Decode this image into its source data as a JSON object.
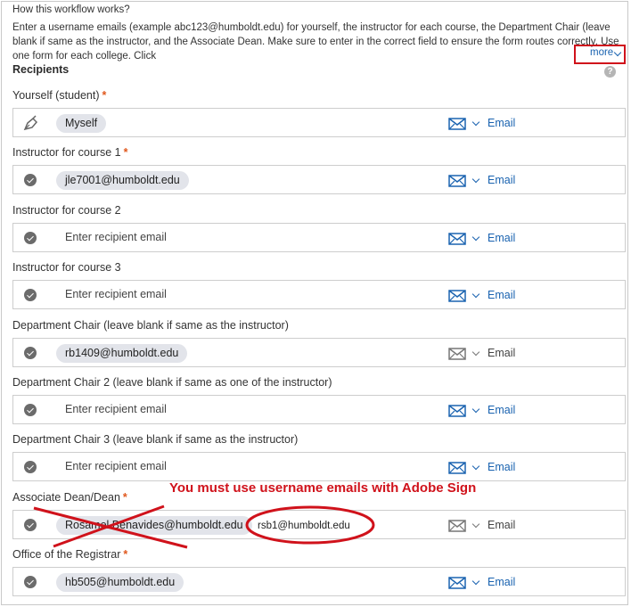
{
  "header": {
    "title": "How this workflow works?",
    "instructions": "Enter a username emails (example abc123@humboldt.edu) for yourself, the instructor for each course, the Department Chair (leave blank if same as the instructor, and the Associate Dean. Make sure to enter in the correct field to ensure the form routes correctly. Use one form for each college. Click",
    "more_label": "more"
  },
  "recipients": {
    "title": "Recipients",
    "help_icon": "question-icon",
    "fields": [
      {
        "label": "Yourself (student)",
        "required": "*",
        "icon": "pen-icon",
        "chip": "Myself",
        "delivery": "Email",
        "accent": "#1a63b0"
      },
      {
        "label": "Instructor for course 1",
        "required": "*",
        "icon": "check-icon",
        "chip": "jle7001@humboldt.edu",
        "delivery": "Email",
        "accent": "#1a63b0"
      },
      {
        "label": "Instructor for course 2",
        "icon": "check-icon",
        "placeholder": "Enter recipient email",
        "delivery": "Email",
        "accent": "#1a63b0"
      },
      {
        "label": "Instructor for course 3",
        "icon": "check-icon",
        "placeholder": "Enter recipient email",
        "delivery": "Email",
        "accent": "#1a63b0"
      },
      {
        "label": "Department Chair (leave blank if same as the instructor)",
        "icon": "check-icon",
        "chip": "rb1409@humboldt.edu",
        "delivery": "Email",
        "accent": "#777777"
      },
      {
        "label": "Department Chair 2 (leave blank if same as one of the instructor)",
        "icon": "check-icon",
        "placeholder": "Enter recipient email",
        "delivery": "Email",
        "accent": "#1a63b0"
      },
      {
        "label": "Department Chair 3 (leave blank if same as the instructor)",
        "icon": "check-icon",
        "placeholder": "Enter recipient email",
        "delivery": "Email",
        "accent": "#1a63b0"
      },
      {
        "label": "Associate Dean/Dean",
        "required": "*",
        "icon": "check-icon",
        "chip": "Rosamel.Benavides@humboldt.edu",
        "delivery": "Email",
        "accent": "#777777"
      },
      {
        "label": "Office of the Registrar",
        "required": "*",
        "icon": "check-icon",
        "chip": "hb505@humboldt.edu",
        "delivery": "Email",
        "accent": "#1a63b0"
      }
    ]
  },
  "annotation": {
    "message": "You must use username emails with Adobe Sign",
    "correct_email": "rsb1@humboldt.edu",
    "color": "#d0121b"
  }
}
